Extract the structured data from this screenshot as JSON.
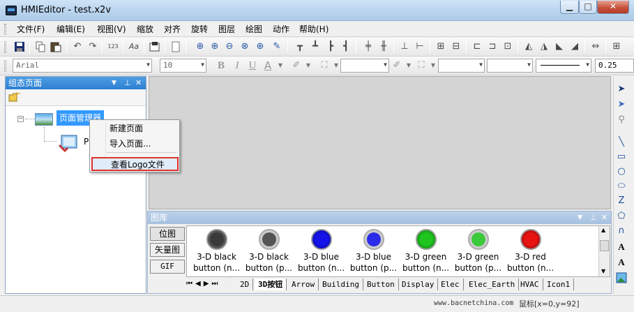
{
  "window": {
    "title": "HMIEditor - test.x2v",
    "min_glyph": "▁",
    "max_glyph": "□",
    "close_glyph": "✕"
  },
  "menu": [
    "文件(F)",
    "编辑(E)",
    "视图(V)",
    "缩放",
    "对齐",
    "旋转",
    "图层",
    "绘图",
    "动作",
    "帮助(H)"
  ],
  "format_toolbar": {
    "font": "Arial",
    "size": "10",
    "bold": "B",
    "italic": "I",
    "underline": "U",
    "text_color": "A",
    "line_width": "0.25"
  },
  "left_panel": {
    "title": "组态页面",
    "tree_root_label": "页面管理器",
    "tree_child_label": "P"
  },
  "context_menu": {
    "items": [
      "新建页面",
      "导入页面...",
      "查看Logo文件"
    ]
  },
  "library": {
    "title": "图库",
    "categories": [
      "位图",
      "矢量图",
      "GIF"
    ],
    "items": [
      {
        "line1": "3-D black",
        "line2": "button (n...",
        "color": "#3a3a3a"
      },
      {
        "line1": "3-D black",
        "line2": "button (p...",
        "color": "#555555"
      },
      {
        "line1": "3-D blue",
        "line2": "button (n...",
        "color": "#1414e8"
      },
      {
        "line1": "3-D blue",
        "line2": "button (p...",
        "color": "#2b2bea"
      },
      {
        "line1": "3-D green",
        "line2": "button (n...",
        "color": "#1fc41f"
      },
      {
        "line1": "3-D green",
        "line2": "button (p...",
        "color": "#3ac93a"
      },
      {
        "line1": "3-D red",
        "line2": "button (n...",
        "color": "#e81414"
      }
    ],
    "tabs": [
      "2D",
      "3D按钮",
      "Arrow",
      "Building",
      "Button",
      "Display",
      "Elec",
      "Elec_Earth",
      "HVAC",
      "Icon1"
    ],
    "active_tab": "3D按钮"
  },
  "status": {
    "website": "www.bacnetchina.com",
    "mouse": "鼠标[x=0,y=92]"
  }
}
